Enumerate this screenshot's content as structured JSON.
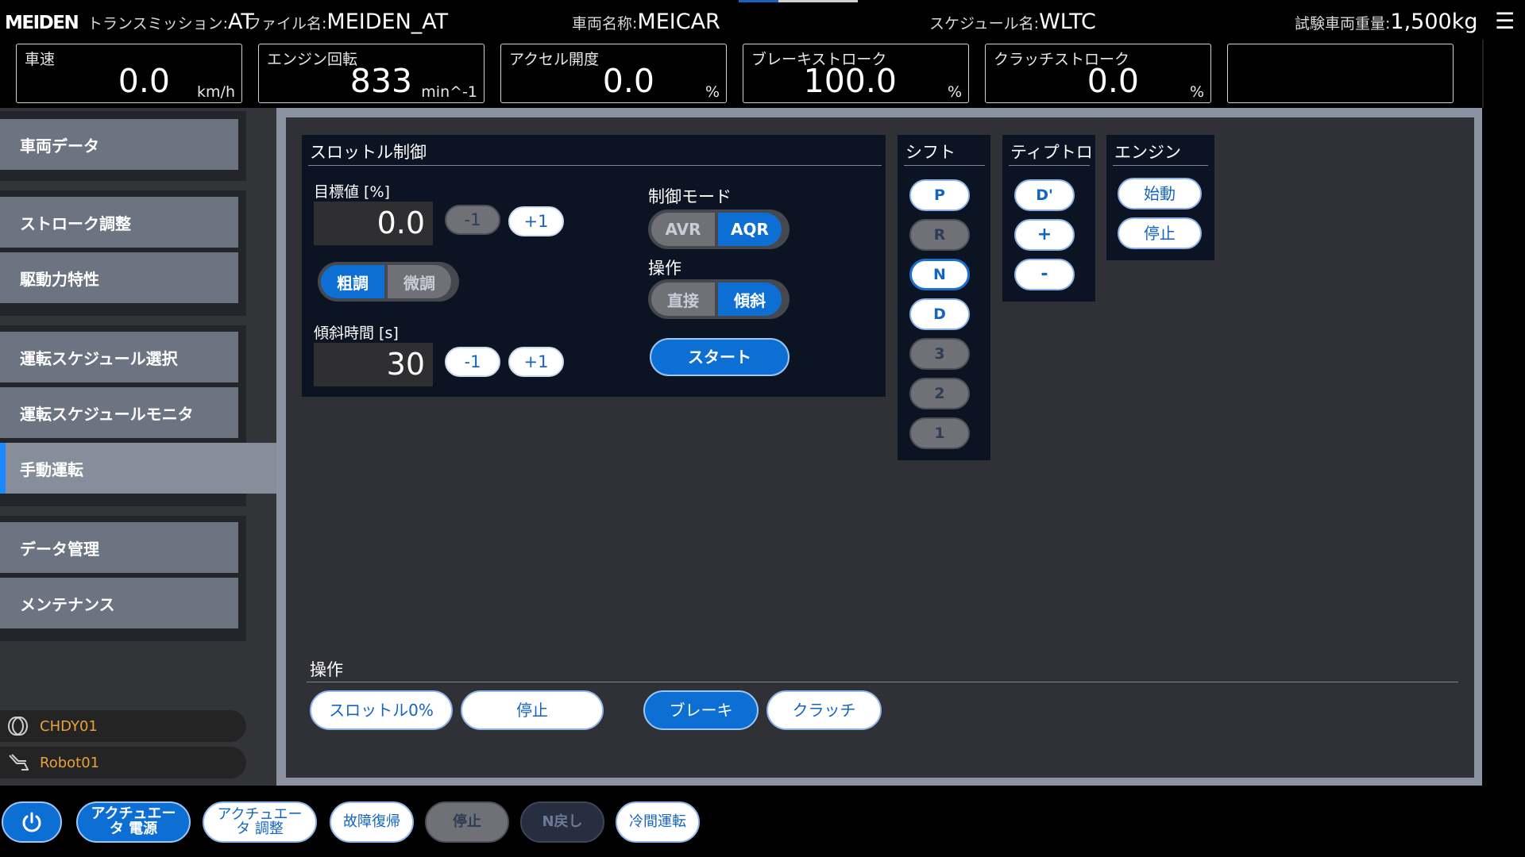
{
  "header": {
    "logo": "MEIDEN",
    "transmission_label": "トランスミッション:",
    "transmission_value": "AT",
    "file_label": "ファイル名:",
    "file_value": "MEIDEN_AT",
    "vehicle_label": "車両名称:",
    "vehicle_value": "MEICAR",
    "schedule_label": "スケジュール名:",
    "schedule_value": "WLTC",
    "weight_label": "試験車両重量:",
    "weight_value": "1,500kg",
    "menu_icon": "hamburger-menu-icon",
    "indicator_color": "#1565c0"
  },
  "gauges": [
    {
      "label": "車速",
      "value": "0.0",
      "unit": "km/h"
    },
    {
      "label": "エンジン回転",
      "value": "833",
      "unit": "min^-1"
    },
    {
      "label": "アクセル開度",
      "value": "0.0",
      "unit": "%"
    },
    {
      "label": "ブレーキストローク",
      "value": "100.0",
      "unit": "%"
    },
    {
      "label": "クラッチストローク",
      "value": "0.0",
      "unit": "%"
    },
    {
      "label": "",
      "value": "",
      "unit": ""
    }
  ],
  "sidebar": {
    "items": [
      {
        "label": "車両データ"
      },
      {
        "label": "ストローク調整"
      },
      {
        "label": "駆動力特性"
      },
      {
        "label": "運転スケジュール選択"
      },
      {
        "label": "運転スケジュールモニタ"
      },
      {
        "label": "手動運転",
        "active": true
      },
      {
        "label": "データ管理"
      },
      {
        "label": "メンテナンス"
      }
    ],
    "devices": [
      {
        "label": "CHDY01",
        "icon": "dynamometer-icon"
      },
      {
        "label": "Robot01",
        "icon": "robot-arm-icon"
      }
    ],
    "accent_color": "#1b8aff"
  },
  "throttle": {
    "title": "スロットル制御",
    "target_label": "目標値 [%]",
    "target_value": "0.0",
    "minus_label": "-1",
    "plus_label": "+1",
    "coarse_label": "粗調",
    "fine_label": "微調",
    "ramp_label": "傾斜時間 [s]",
    "ramp_value": "30",
    "ramp_minus_label": "-1",
    "ramp_plus_label": "+1",
    "mode_label": "制御モード",
    "mode_avr": "AVR",
    "mode_aqr": "AQR",
    "op_label": "操作",
    "op_direct": "直接",
    "op_ramp": "傾斜",
    "start_label": "スタート"
  },
  "shift": {
    "title": "シフト",
    "gears": [
      "P",
      "R",
      "N",
      "D",
      "3",
      "2",
      "1"
    ]
  },
  "tiptronic": {
    "title": "ティプトロ",
    "buttons": [
      "D'",
      "+",
      "-"
    ]
  },
  "engine": {
    "title": "エンジン",
    "start_label": "始動",
    "stop_label": "停止"
  },
  "operations": {
    "title": "操作",
    "throttle_zero": "スロットル0%",
    "stop": "停止",
    "brake": "ブレーキ",
    "clutch": "クラッチ"
  },
  "bottombar": {
    "power_icon": "power-icon",
    "actuator_power": "アクチュエータ 電源",
    "actuator_adjust": "アクチュエータ 調整",
    "fault_reset": "故障復帰",
    "stop": "停止",
    "n_return": "N戻し",
    "cold_run": "冷間運転"
  },
  "colors": {
    "primary_blue": "#0d6fd4",
    "panel_bg": "#0c1424",
    "device_text": "#e8a13c"
  }
}
